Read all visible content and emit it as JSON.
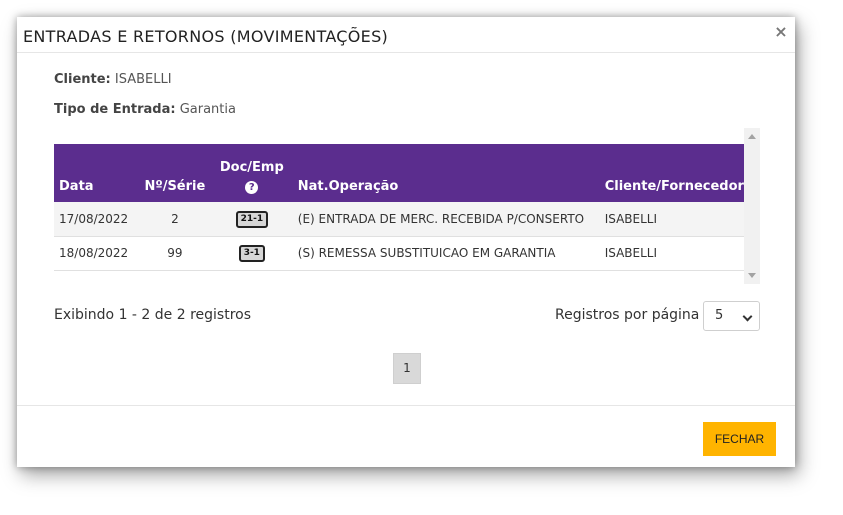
{
  "modal": {
    "title": "ENTRADAS E RETORNOS (MOVIMENTAÇÕES)",
    "close_icon": "×"
  },
  "info": {
    "cliente_label": "Cliente:",
    "cliente_value": "ISABELLI",
    "tipo_label": "Tipo de Entrada:",
    "tipo_value": "Garantia"
  },
  "table": {
    "headers": {
      "data": "Data",
      "nserie": "Nº/Série",
      "docemp": "Doc/Emp",
      "help_icon": "?",
      "natop": "Nat.Operação",
      "cliforn": "Cliente/Fornecedor"
    },
    "rows": [
      {
        "data": "17/08/2022",
        "nserie": "2",
        "doc": "21-1",
        "natop": "(E) ENTRADA DE MERC. RECEBIDA P/CONSERTO",
        "cliforn": "ISABELLI"
      },
      {
        "data": "18/08/2022",
        "nserie": "99",
        "doc": "3-1",
        "natop": "(S) REMESSA SUBSTITUICAO EM GARANTIA",
        "cliforn": "ISABELLI"
      }
    ]
  },
  "pagination": {
    "summary": "Exibindo 1 - 2 de 2 registros",
    "per_page_label": "Registros por página",
    "per_page_value": "5",
    "current_page": "1"
  },
  "footer": {
    "close_label": "FECHAR"
  },
  "colors": {
    "header_bg": "#5b2d8e",
    "button_accent": "#ffb400"
  }
}
